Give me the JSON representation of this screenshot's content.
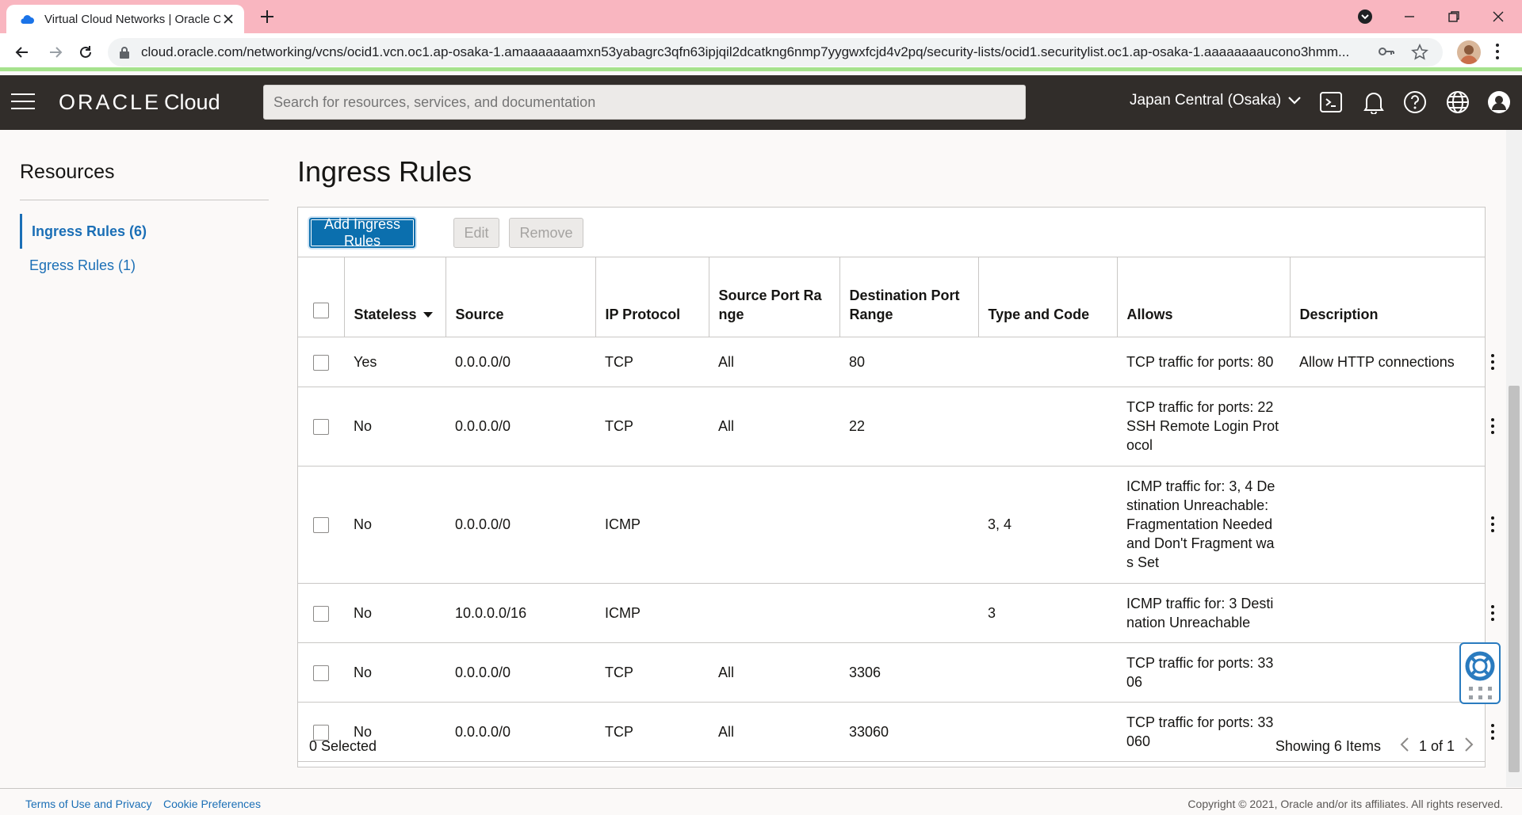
{
  "browser": {
    "tab_title": "Virtual Cloud Networks | Oracle C",
    "url": "cloud.oracle.com/networking/vcns/ocid1.vcn.oc1.ap-osaka-1.amaaaaaaamxn53yabagrc3qfn63ipjqil2dcatkng6nmp7yygwxfcjd4v2pq/security-lists/ocid1.securitylist.oc1.ap-osaka-1.aaaaaaaaucono3hmm..."
  },
  "header": {
    "brand_oracle": "ORACLE",
    "brand_cloud": "Cloud",
    "search_placeholder": "Search for resources, services, and documentation",
    "region": "Japan Central (Osaka)"
  },
  "sidebar": {
    "title": "Resources",
    "items": [
      {
        "label": "Ingress Rules (6)",
        "active": true
      },
      {
        "label": "Egress Rules (1)",
        "active": false
      }
    ]
  },
  "main": {
    "title": "Ingress Rules",
    "toolbar": {
      "add_label": "Add Ingress Rules",
      "edit_label": "Edit",
      "remove_label": "Remove"
    },
    "columns": [
      "Stateless",
      "Source",
      "IP Protocol",
      "Source Port Range",
      "Destination Port Range",
      "Type and Code",
      "Allows",
      "Description"
    ],
    "rows": [
      {
        "stateless": "Yes",
        "source": "0.0.0.0/0",
        "protocol": "TCP",
        "src_port": "All",
        "dst_port": "80",
        "type_code": "",
        "allows": "TCP traffic for ports: 80",
        "description": "Allow HTTP connections"
      },
      {
        "stateless": "No",
        "source": "0.0.0.0/0",
        "protocol": "TCP",
        "src_port": "All",
        "dst_port": "22",
        "type_code": "",
        "allows": "TCP traffic for ports: 22 SSH Remote Login Protocol",
        "description": ""
      },
      {
        "stateless": "No",
        "source": "0.0.0.0/0",
        "protocol": "ICMP",
        "src_port": "",
        "dst_port": "",
        "type_code": "3, 4",
        "allows": "ICMP traffic for: 3, 4 Destination Unreachable: Fragmentation Needed and Don't Fragment was Set",
        "description": ""
      },
      {
        "stateless": "No",
        "source": "10.0.0.0/16",
        "protocol": "ICMP",
        "src_port": "",
        "dst_port": "",
        "type_code": "3",
        "allows": "ICMP traffic for: 3 Destination Unreachable",
        "description": ""
      },
      {
        "stateless": "No",
        "source": "0.0.0.0/0",
        "protocol": "TCP",
        "src_port": "All",
        "dst_port": "3306",
        "type_code": "",
        "allows": "TCP traffic for ports: 3306",
        "description": ""
      },
      {
        "stateless": "No",
        "source": "0.0.0.0/0",
        "protocol": "TCP",
        "src_port": "All",
        "dst_port": "33060",
        "type_code": "",
        "allows": "TCP traffic for ports: 33060",
        "description": ""
      }
    ],
    "selected_text": "0 Selected",
    "showing_text": "Showing 6 Items",
    "page_text": "1 of 1"
  },
  "footer": {
    "terms": "Terms of Use and Privacy",
    "cookies": "Cookie Preferences",
    "copyright": "Copyright © 2021, Oracle and/or its affiliates. All rights reserved."
  }
}
